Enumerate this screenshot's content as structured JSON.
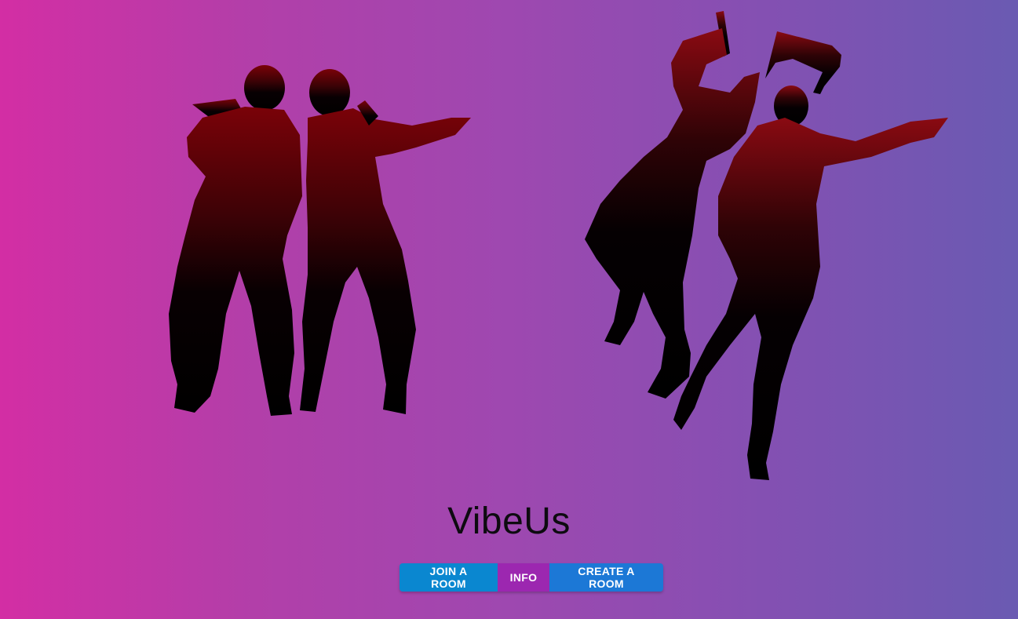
{
  "app": {
    "title": "VibeUs"
  },
  "actions": {
    "join_label": "JOIN A ROOM",
    "info_label": "INFO",
    "create_label": "CREATE A ROOM"
  },
  "colors": {
    "background_left": "#d32ea4",
    "background_right": "#6a5ab2",
    "join_button": "#0a87d0",
    "info_button": "#9c27b0",
    "create_button": "#1c78d6",
    "title_text": "#0d0b10"
  }
}
